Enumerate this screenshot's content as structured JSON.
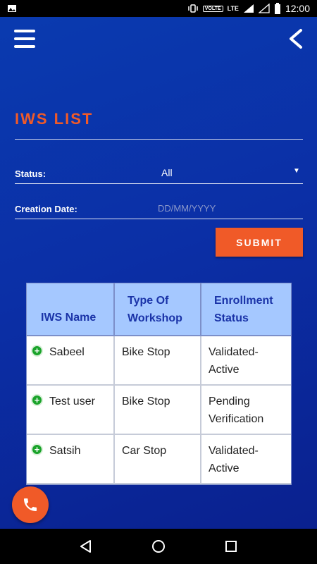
{
  "status_bar": {
    "time": "12:00",
    "volte": "VOLTE",
    "network": "LTE"
  },
  "header": {
    "title": "IWS LIST"
  },
  "filters": {
    "status_label": "Status:",
    "status_value": "All",
    "creation_date_label": "Creation Date:",
    "creation_date_placeholder": "DD/MM/YYYY"
  },
  "submit_label": "SUBMIT",
  "table": {
    "headers": [
      "IWS Name",
      "Type Of Workshop",
      "Enrollment Status"
    ],
    "rows": [
      {
        "name": "Sabeel",
        "type": "Bike Stop",
        "status": "Validated-Active"
      },
      {
        "name": "Test user",
        "type": "Bike Stop",
        "status": "Pending Verification"
      },
      {
        "name": "Satsih",
        "type": "Car Stop",
        "status": "Validated-Active"
      }
    ]
  },
  "colors": {
    "accent": "#f05a28",
    "header_bg": "#a5c8ff",
    "header_text": "#1a33a8",
    "background": "#0b2fa6"
  }
}
